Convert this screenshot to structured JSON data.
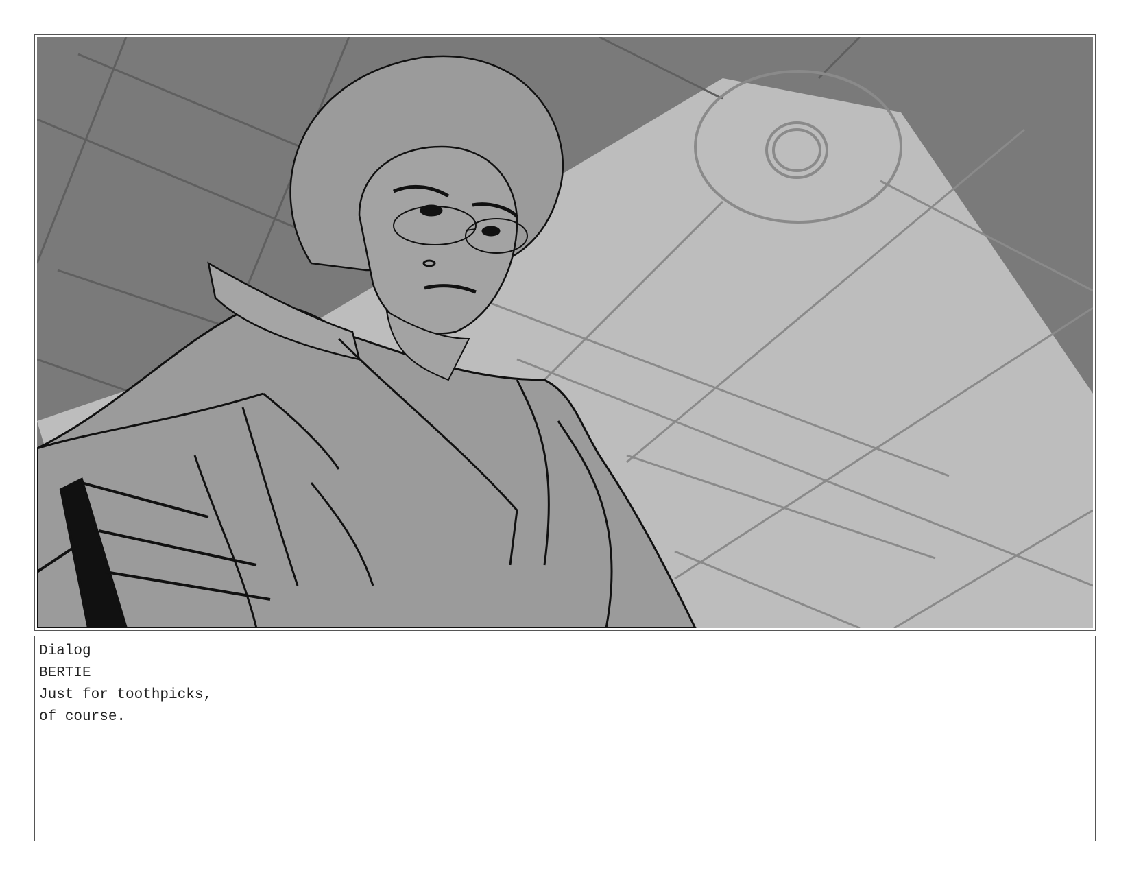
{
  "panel": {
    "image": {
      "kind": "storyboard-sketch",
      "palette": {
        "wall": "#7a7a7a",
        "light_beam": "#bdbdbd",
        "figure": "#9b9b9b",
        "line": "#111111",
        "grid": "#858585"
      }
    }
  },
  "notes": {
    "section_label": "Dialog",
    "character": "BERTIE",
    "lines": [
      "Just for toothpicks,",
      "of course."
    ]
  }
}
